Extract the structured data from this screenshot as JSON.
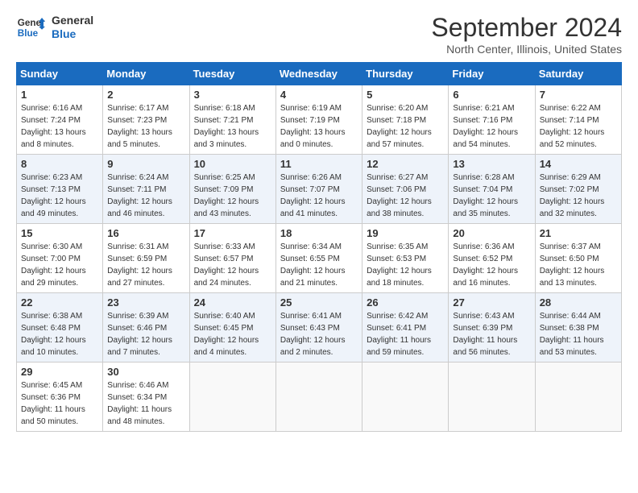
{
  "header": {
    "logo_line1": "General",
    "logo_line2": "Blue",
    "month_title": "September 2024",
    "location": "North Center, Illinois, United States"
  },
  "weekdays": [
    "Sunday",
    "Monday",
    "Tuesday",
    "Wednesday",
    "Thursday",
    "Friday",
    "Saturday"
  ],
  "weeks": [
    [
      {
        "day": "1",
        "sunrise": "Sunrise: 6:16 AM",
        "sunset": "Sunset: 7:24 PM",
        "daylight": "Daylight: 13 hours and 8 minutes."
      },
      {
        "day": "2",
        "sunrise": "Sunrise: 6:17 AM",
        "sunset": "Sunset: 7:23 PM",
        "daylight": "Daylight: 13 hours and 5 minutes."
      },
      {
        "day": "3",
        "sunrise": "Sunrise: 6:18 AM",
        "sunset": "Sunset: 7:21 PM",
        "daylight": "Daylight: 13 hours and 3 minutes."
      },
      {
        "day": "4",
        "sunrise": "Sunrise: 6:19 AM",
        "sunset": "Sunset: 7:19 PM",
        "daylight": "Daylight: 13 hours and 0 minutes."
      },
      {
        "day": "5",
        "sunrise": "Sunrise: 6:20 AM",
        "sunset": "Sunset: 7:18 PM",
        "daylight": "Daylight: 12 hours and 57 minutes."
      },
      {
        "day": "6",
        "sunrise": "Sunrise: 6:21 AM",
        "sunset": "Sunset: 7:16 PM",
        "daylight": "Daylight: 12 hours and 54 minutes."
      },
      {
        "day": "7",
        "sunrise": "Sunrise: 6:22 AM",
        "sunset": "Sunset: 7:14 PM",
        "daylight": "Daylight: 12 hours and 52 minutes."
      }
    ],
    [
      {
        "day": "8",
        "sunrise": "Sunrise: 6:23 AM",
        "sunset": "Sunset: 7:13 PM",
        "daylight": "Daylight: 12 hours and 49 minutes."
      },
      {
        "day": "9",
        "sunrise": "Sunrise: 6:24 AM",
        "sunset": "Sunset: 7:11 PM",
        "daylight": "Daylight: 12 hours and 46 minutes."
      },
      {
        "day": "10",
        "sunrise": "Sunrise: 6:25 AM",
        "sunset": "Sunset: 7:09 PM",
        "daylight": "Daylight: 12 hours and 43 minutes."
      },
      {
        "day": "11",
        "sunrise": "Sunrise: 6:26 AM",
        "sunset": "Sunset: 7:07 PM",
        "daylight": "Daylight: 12 hours and 41 minutes."
      },
      {
        "day": "12",
        "sunrise": "Sunrise: 6:27 AM",
        "sunset": "Sunset: 7:06 PM",
        "daylight": "Daylight: 12 hours and 38 minutes."
      },
      {
        "day": "13",
        "sunrise": "Sunrise: 6:28 AM",
        "sunset": "Sunset: 7:04 PM",
        "daylight": "Daylight: 12 hours and 35 minutes."
      },
      {
        "day": "14",
        "sunrise": "Sunrise: 6:29 AM",
        "sunset": "Sunset: 7:02 PM",
        "daylight": "Daylight: 12 hours and 32 minutes."
      }
    ],
    [
      {
        "day": "15",
        "sunrise": "Sunrise: 6:30 AM",
        "sunset": "Sunset: 7:00 PM",
        "daylight": "Daylight: 12 hours and 29 minutes."
      },
      {
        "day": "16",
        "sunrise": "Sunrise: 6:31 AM",
        "sunset": "Sunset: 6:59 PM",
        "daylight": "Daylight: 12 hours and 27 minutes."
      },
      {
        "day": "17",
        "sunrise": "Sunrise: 6:33 AM",
        "sunset": "Sunset: 6:57 PM",
        "daylight": "Daylight: 12 hours and 24 minutes."
      },
      {
        "day": "18",
        "sunrise": "Sunrise: 6:34 AM",
        "sunset": "Sunset: 6:55 PM",
        "daylight": "Daylight: 12 hours and 21 minutes."
      },
      {
        "day": "19",
        "sunrise": "Sunrise: 6:35 AM",
        "sunset": "Sunset: 6:53 PM",
        "daylight": "Daylight: 12 hours and 18 minutes."
      },
      {
        "day": "20",
        "sunrise": "Sunrise: 6:36 AM",
        "sunset": "Sunset: 6:52 PM",
        "daylight": "Daylight: 12 hours and 16 minutes."
      },
      {
        "day": "21",
        "sunrise": "Sunrise: 6:37 AM",
        "sunset": "Sunset: 6:50 PM",
        "daylight": "Daylight: 12 hours and 13 minutes."
      }
    ],
    [
      {
        "day": "22",
        "sunrise": "Sunrise: 6:38 AM",
        "sunset": "Sunset: 6:48 PM",
        "daylight": "Daylight: 12 hours and 10 minutes."
      },
      {
        "day": "23",
        "sunrise": "Sunrise: 6:39 AM",
        "sunset": "Sunset: 6:46 PM",
        "daylight": "Daylight: 12 hours and 7 minutes."
      },
      {
        "day": "24",
        "sunrise": "Sunrise: 6:40 AM",
        "sunset": "Sunset: 6:45 PM",
        "daylight": "Daylight: 12 hours and 4 minutes."
      },
      {
        "day": "25",
        "sunrise": "Sunrise: 6:41 AM",
        "sunset": "Sunset: 6:43 PM",
        "daylight": "Daylight: 12 hours and 2 minutes."
      },
      {
        "day": "26",
        "sunrise": "Sunrise: 6:42 AM",
        "sunset": "Sunset: 6:41 PM",
        "daylight": "Daylight: 11 hours and 59 minutes."
      },
      {
        "day": "27",
        "sunrise": "Sunrise: 6:43 AM",
        "sunset": "Sunset: 6:39 PM",
        "daylight": "Daylight: 11 hours and 56 minutes."
      },
      {
        "day": "28",
        "sunrise": "Sunrise: 6:44 AM",
        "sunset": "Sunset: 6:38 PM",
        "daylight": "Daylight: 11 hours and 53 minutes."
      }
    ],
    [
      {
        "day": "29",
        "sunrise": "Sunrise: 6:45 AM",
        "sunset": "Sunset: 6:36 PM",
        "daylight": "Daylight: 11 hours and 50 minutes."
      },
      {
        "day": "30",
        "sunrise": "Sunrise: 6:46 AM",
        "sunset": "Sunset: 6:34 PM",
        "daylight": "Daylight: 11 hours and 48 minutes."
      },
      null,
      null,
      null,
      null,
      null
    ]
  ]
}
